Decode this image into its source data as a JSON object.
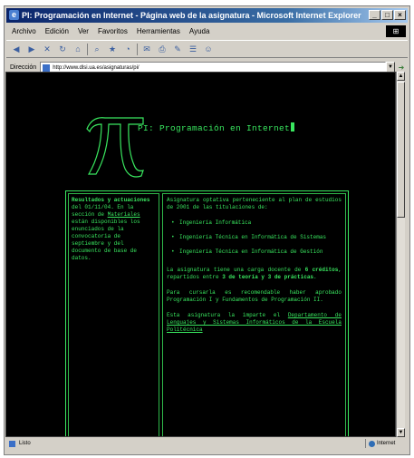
{
  "window": {
    "title": "PI: Programación en Internet - Página web de la asignatura - Microsoft Internet Explorer",
    "buttons": {
      "minimize": "_",
      "maximize": "□",
      "close": "×"
    }
  },
  "menu": {
    "items": [
      "Archivo",
      "Edición",
      "Ver",
      "Favoritos",
      "Herramientas",
      "Ayuda"
    ]
  },
  "address": {
    "label": "Dirección",
    "url": "http://www.dlsi.ua.es/asignaturas/pi/",
    "go_icon": "go-arrow-icon"
  },
  "page": {
    "logo_symbol": "π",
    "site_title": "PI: Programación en Internet",
    "sidebar": {
      "heading": "Resultados y actuaciones",
      "text_1": "del 01/11/04. En la sección de",
      "link": "Materiales",
      "text_2": "están disponibles los enunciados de la convocatoria de septiembre y del documento de base de datos."
    },
    "main": {
      "intro": "Asignatura optativa perteneciente al plan de estudios de 2001 de las titulaciones de:",
      "degrees": [
        "Ingeniería Informática",
        "Ingeniería Técnica en Informática de Sistemas",
        "Ingeniería Técnica en Informática de Gestión"
      ],
      "load_text_1": "La asignatura tiene una carga docente de",
      "load_bold_1": "6 créditos",
      "load_text_2": ", repartidos entre",
      "load_bold_2": "3 de teoría y 3 de prácticas",
      "load_text_3": ".",
      "prereq": "Para cursarla es recomendable haber aprobado Programación I y Fundamentos de Programación II.",
      "dept_text": "Esta asignatura la imparte el",
      "dept_link": "Departamento de Lenguajes y Sistemas Informáticos de la Escuela Politécnica"
    }
  },
  "status": {
    "text": "Listo",
    "zone": "Internet"
  },
  "colors": {
    "terminal_green": "#39e75f",
    "page_background": "#000000",
    "titlebar": "#0a246a"
  }
}
